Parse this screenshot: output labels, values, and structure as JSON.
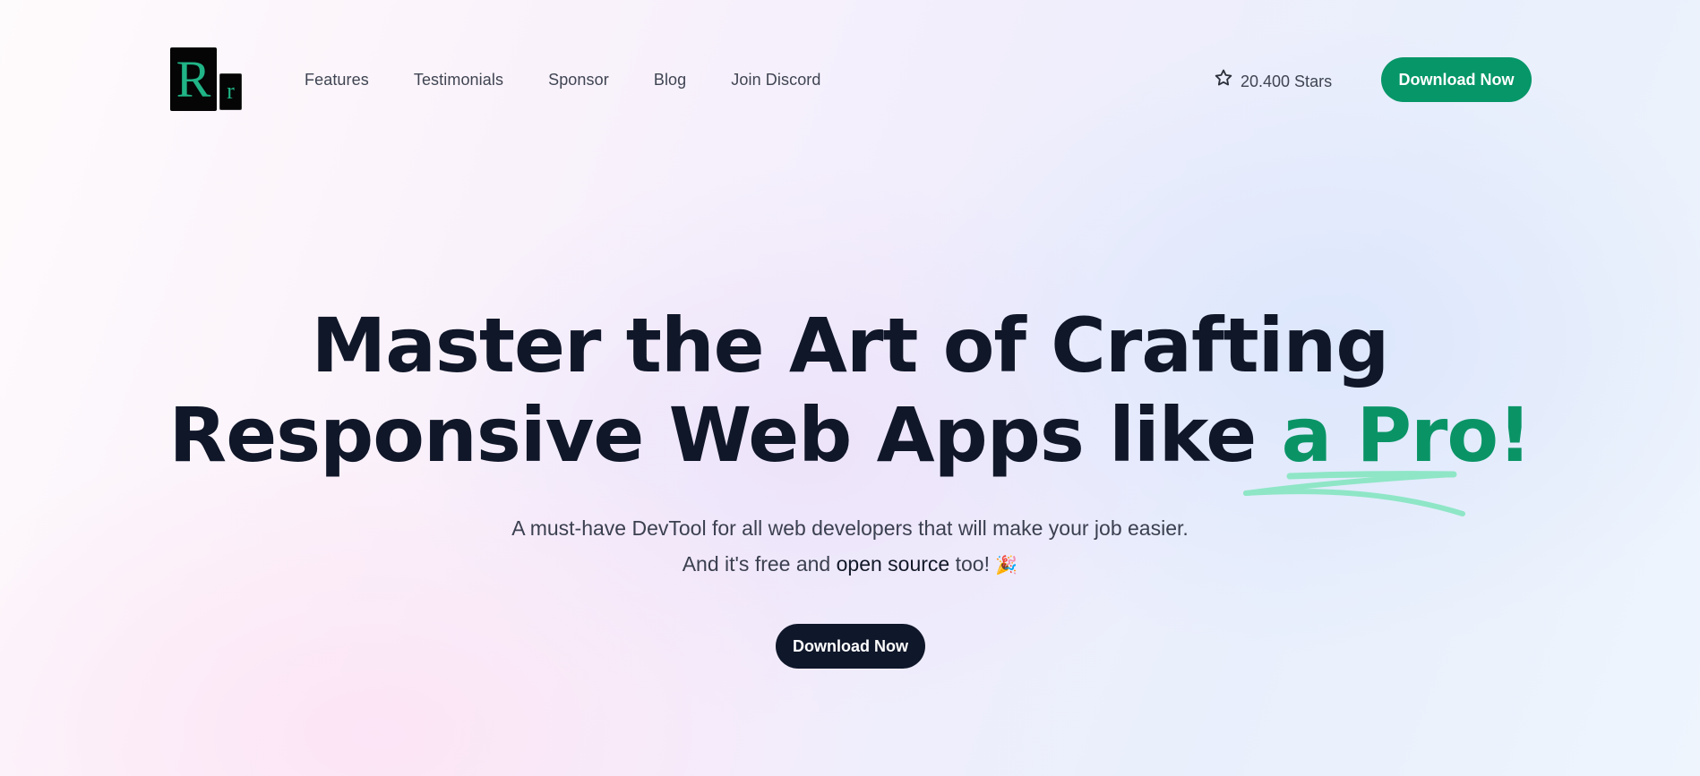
{
  "nav": {
    "logo": {
      "big_letter": "R",
      "small_letter": "r"
    },
    "links": [
      {
        "label": "Features"
      },
      {
        "label": "Testimonials"
      },
      {
        "label": "Sponsor"
      },
      {
        "label": "Blog"
      },
      {
        "label": "Join Discord"
      }
    ],
    "stars": {
      "icon": "star-icon",
      "label": "20.400 Stars"
    },
    "cta_label": "Download Now"
  },
  "hero": {
    "title_line1": "Master the Art of Crafting",
    "title_line2_prefix": "Responsive Web Apps like ",
    "title_line2_accent": "a Pro!",
    "subtitle_line1": "A must-have DevTool for all web developers that will make your job easier.",
    "subtitle_line2_prefix": "And it's free and ",
    "subtitle_line2_strong": "open source",
    "subtitle_line2_suffix": " too! ",
    "subtitle_emoji": "🎉",
    "cta_label": "Download Now"
  },
  "colors": {
    "accent_green": "#069668",
    "scribble_green": "#8ee6c6",
    "heading_dark": "#101729",
    "dark_button": "#0f172a"
  }
}
